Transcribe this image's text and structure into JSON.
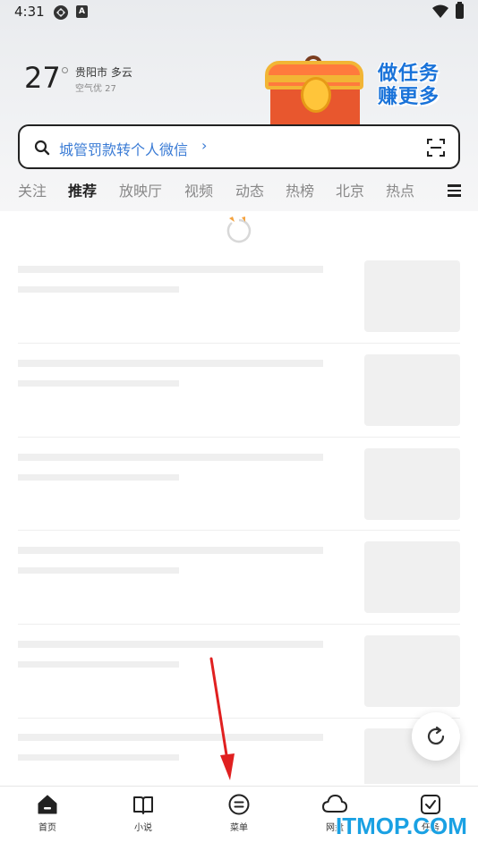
{
  "status_bar": {
    "time": "4:31",
    "icon_a": "A"
  },
  "weather": {
    "temp": "27",
    "city_weather": "贵阳市 多云",
    "air": "空气优 27"
  },
  "promo": {
    "line1": "做任务",
    "line2": "赚更多",
    "icon": "treasure-chest-icon"
  },
  "search": {
    "text": "城管罚款转个人微信",
    "chevron": "›"
  },
  "tabs": [
    {
      "label": "关注",
      "active": false
    },
    {
      "label": "推荐",
      "active": true
    },
    {
      "label": "放映厅",
      "active": false
    },
    {
      "label": "视频",
      "active": false
    },
    {
      "label": "动态",
      "active": false
    },
    {
      "label": "热榜",
      "active": false
    },
    {
      "label": "北京",
      "active": false
    },
    {
      "label": "热点",
      "active": false
    }
  ],
  "bottom_nav": [
    {
      "label": "首页",
      "icon": "home-icon"
    },
    {
      "label": "小说",
      "icon": "book-icon"
    },
    {
      "label": "菜单",
      "icon": "menu-icon"
    },
    {
      "label": "网盘",
      "icon": "cloud-icon"
    },
    {
      "label": "任务",
      "icon": "task-icon"
    }
  ],
  "watermark": "ITMOP.COM",
  "colors": {
    "accent": "#3a7bd5",
    "annotation": "#e02020"
  }
}
